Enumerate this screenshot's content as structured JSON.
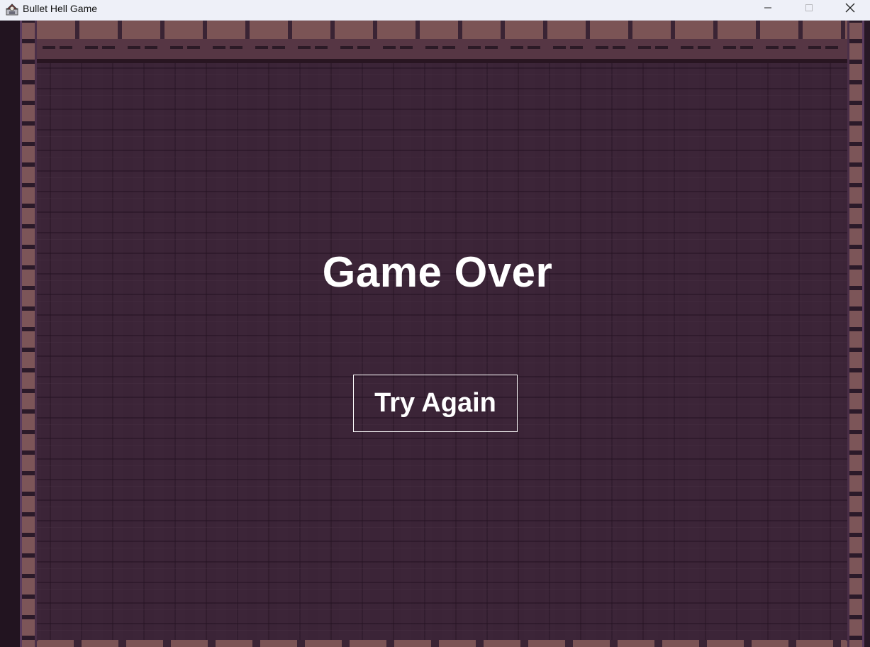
{
  "window": {
    "title": "Bullet Hell Game",
    "icon": "java-app-icon",
    "controls": {
      "minimize": "minimize-icon",
      "maximize": "maximize-icon",
      "close": "close-icon"
    }
  },
  "game": {
    "screen": "game-over",
    "title": "Game Over",
    "try_again_label": "Try Again"
  },
  "colors": {
    "floor": "#3c2538",
    "brick": "#7b5455",
    "text": "#ffffff",
    "titlebar": "#eef0f8"
  }
}
